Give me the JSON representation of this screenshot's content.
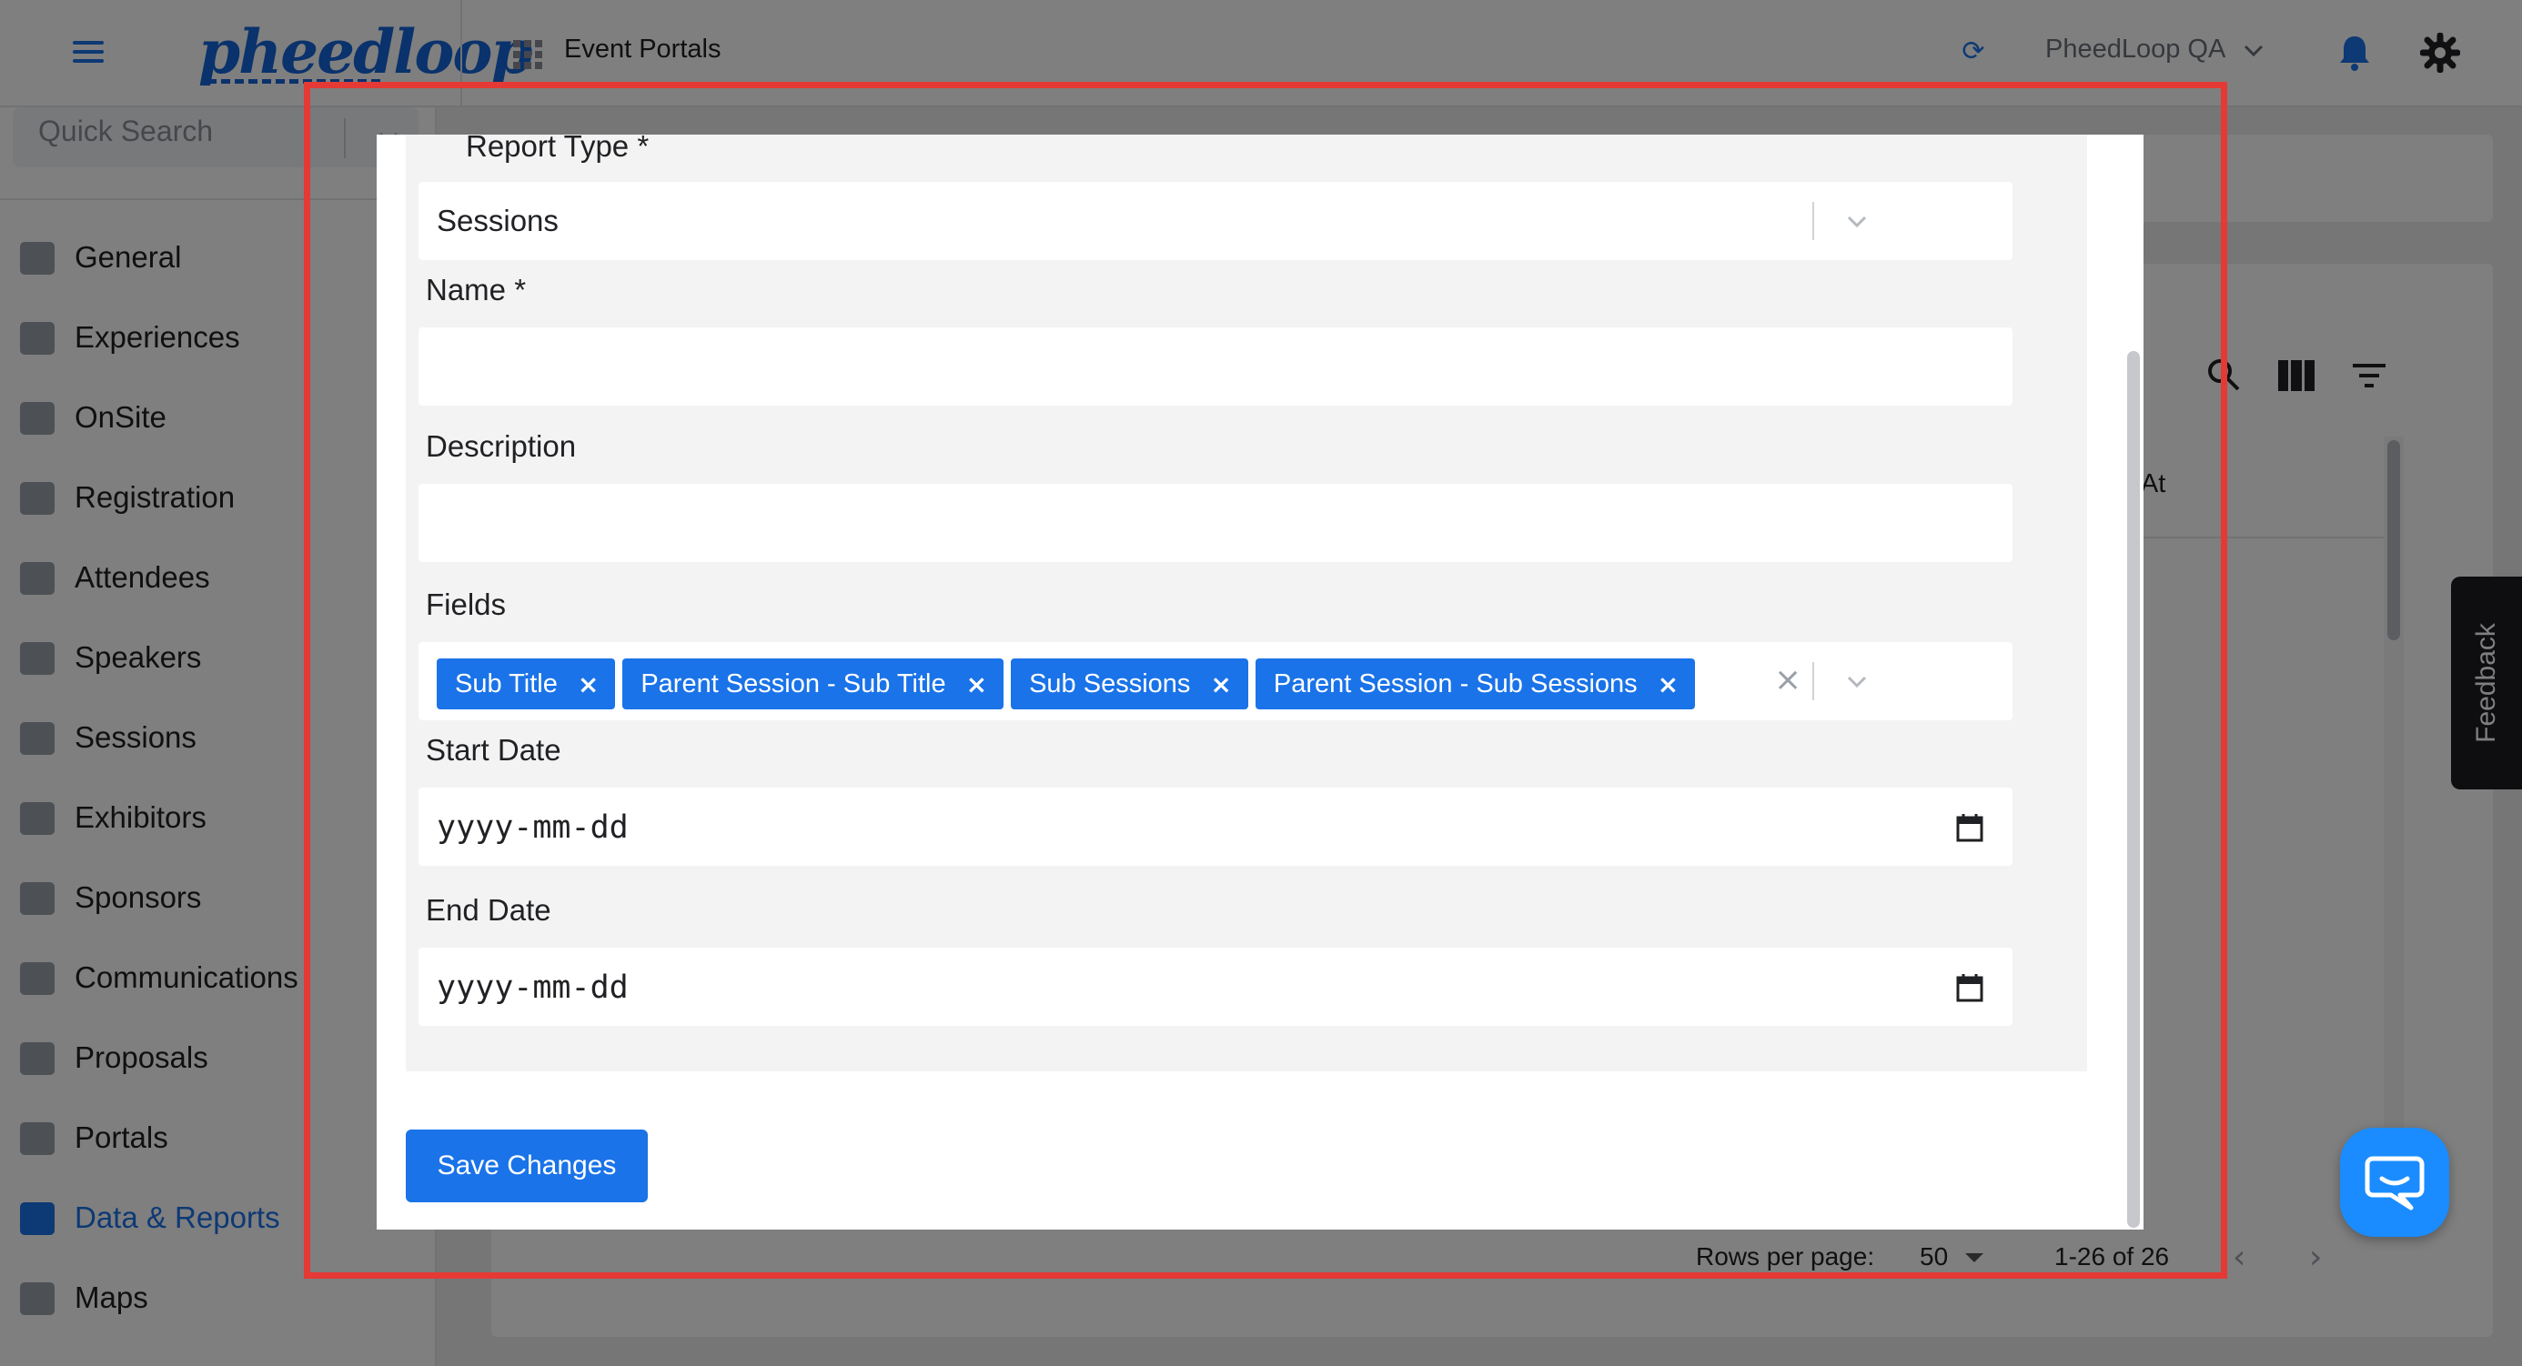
{
  "header": {
    "logo": "pheedloop",
    "section_title": "Event Portals",
    "org_name": "PheedLoop QA"
  },
  "sidebar": {
    "quick_search_placeholder": "Quick Search",
    "items": [
      {
        "label": "General"
      },
      {
        "label": "Experiences"
      },
      {
        "label": "OnSite"
      },
      {
        "label": "Registration"
      },
      {
        "label": "Attendees"
      },
      {
        "label": "Speakers"
      },
      {
        "label": "Sessions"
      },
      {
        "label": "Exhibitors"
      },
      {
        "label": "Sponsors"
      },
      {
        "label": "Communications"
      },
      {
        "label": "Proposals"
      },
      {
        "label": "Portals"
      },
      {
        "label": "Data & Reports"
      },
      {
        "label": "Maps"
      }
    ],
    "active_item": "Data & Reports"
  },
  "background_table": {
    "partial_column_header": "l At",
    "rows_per_page_label": "Rows per page:",
    "rows_per_page_value": "50",
    "range_text": "1-26 of 26"
  },
  "feedback": {
    "label": "Feedback"
  },
  "modal": {
    "report_type": {
      "label": "Report Type *",
      "value": "Sessions"
    },
    "name": {
      "label": "Name *",
      "value": ""
    },
    "description": {
      "label": "Description",
      "value": ""
    },
    "fields": {
      "label": "Fields",
      "selected": [
        {
          "label": "Sub Title"
        },
        {
          "label": "Parent Session - Sub Title"
        },
        {
          "label": "Sub Sessions"
        },
        {
          "label": "Parent Session - Sub Sessions"
        }
      ]
    },
    "start_date": {
      "label": "Start Date",
      "placeholder": "yyyy-mm-dd"
    },
    "end_date": {
      "label": "End Date",
      "placeholder": "yyyy-mm-dd"
    },
    "save_label": "Save Changes"
  },
  "colors": {
    "accent": "#1a73e8",
    "highlight": "#e53935",
    "chat": "#1a8cff"
  },
  "icons": {
    "menu": "hamburger-icon",
    "apps": "grid-icon",
    "refresh": "refresh-icon",
    "notifications": "bell-icon",
    "settings": "gear-icon",
    "chat": "chat-icon"
  }
}
